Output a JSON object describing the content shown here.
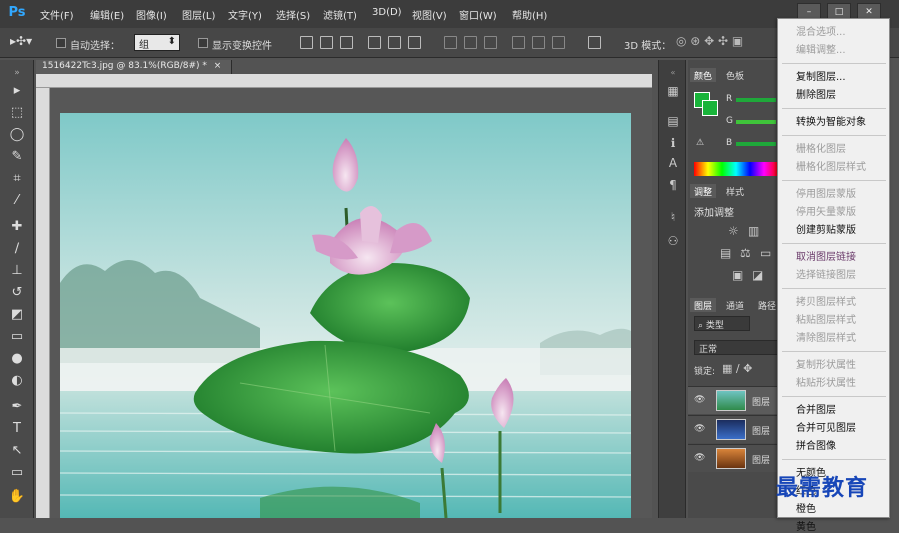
{
  "app": {
    "logo": "Ps"
  },
  "menubar": {
    "items": [
      "文件(F)",
      "编辑(E)",
      "图像(I)",
      "图层(L)",
      "文字(Y)",
      "选择(S)",
      "滤镜(T)",
      "3D(D)",
      "视图(V)",
      "窗口(W)",
      "帮助(H)"
    ]
  },
  "window_controls": [
    "–",
    "□",
    "✕"
  ],
  "options": {
    "auto_select_label": "自动选择：",
    "auto_select_value": "组",
    "show_transform_label": "显示变换控件",
    "mode_3d_label": "3D 模式："
  },
  "document": {
    "tab_title": "1516422Tc3.jpg @ 83.1%(RGB/8#) *",
    "tab_close": "×"
  },
  "panels": {
    "color_tabs": [
      "颜色",
      "色板"
    ],
    "slider_labels": [
      "R",
      "G",
      "B"
    ],
    "adjust_tabs": [
      "调整",
      "样式"
    ],
    "adjust_title": "添加调整",
    "layers_tabs": [
      "图层",
      "通道",
      "路径"
    ],
    "layer_filter": "类型",
    "blend_mode": "正常",
    "lock_label": "锁定:",
    "layer_rows": [
      {
        "name": "图层"
      },
      {
        "name": "图层"
      },
      {
        "name": "图层"
      }
    ]
  },
  "context_menu": {
    "items": [
      {
        "label": "混合选项...",
        "disabled": true
      },
      {
        "label": "编辑调整...",
        "disabled": true
      },
      {
        "sep": true
      },
      {
        "label": "复制图层...",
        "disabled": false
      },
      {
        "label": "删除图层",
        "disabled": false
      },
      {
        "sep": true
      },
      {
        "label": "转换为智能对象",
        "disabled": false
      },
      {
        "sep": true
      },
      {
        "label": "栅格化图层",
        "disabled": true
      },
      {
        "label": "栅格化图层样式",
        "disabled": true
      },
      {
        "sep": true
      },
      {
        "label": "停用图层蒙版",
        "disabled": true
      },
      {
        "label": "停用矢量蒙版",
        "disabled": true
      },
      {
        "label": "创建剪贴蒙版",
        "disabled": false
      },
      {
        "sep": true
      },
      {
        "label": "取消图层链接",
        "disabled": false,
        "highlighted": true
      },
      {
        "label": "选择链接图层",
        "disabled": true
      },
      {
        "sep": true
      },
      {
        "label": "拷贝图层样式",
        "disabled": true
      },
      {
        "label": "粘贴图层样式",
        "disabled": true
      },
      {
        "label": "清除图层样式",
        "disabled": true
      },
      {
        "sep": true
      },
      {
        "label": "复制形状属性",
        "disabled": true
      },
      {
        "label": "粘贴形状属性",
        "disabled": true
      },
      {
        "sep": true
      },
      {
        "label": "合并图层",
        "disabled": false
      },
      {
        "label": "合并可见图层",
        "disabled": false
      },
      {
        "label": "拼合图像",
        "disabled": false
      },
      {
        "sep": true
      },
      {
        "label": "无颜色",
        "disabled": false
      },
      {
        "label": "红色",
        "disabled": false
      },
      {
        "label": "橙色",
        "disabled": false
      },
      {
        "label": "黄色",
        "disabled": false
      }
    ]
  },
  "watermark": "最需教育",
  "colors": {
    "accent_highlight": "#e8175d",
    "foreground_swatch": "#19b43a",
    "ps_blue": "#31a8ff"
  }
}
